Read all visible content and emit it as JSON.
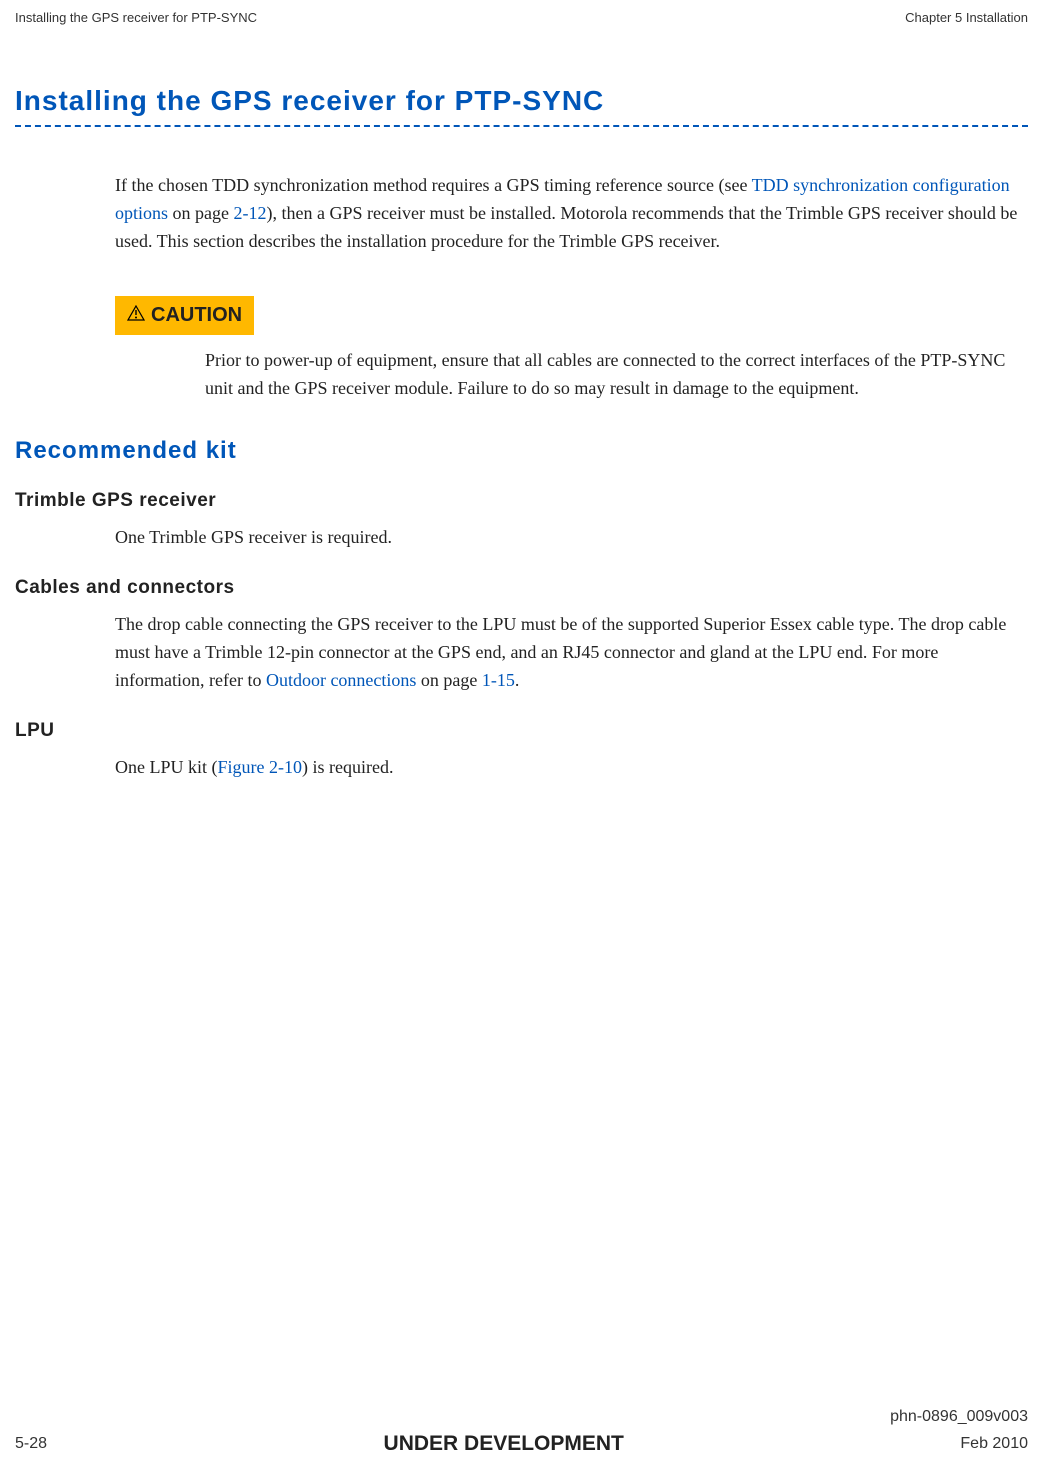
{
  "header": {
    "left": "Installing the GPS receiver for PTP-SYNC",
    "right": "Chapter 5 Installation"
  },
  "title": "Installing the GPS receiver for PTP-SYNC",
  "intro_part1": "If the chosen TDD synchronization method requires a GPS timing reference source (see ",
  "intro_link1": "TDD synchronization configuration options",
  "intro_part2": " on page ",
  "intro_link2": "2-12",
  "intro_part3": "), then a GPS receiver must be installed. Motorola recommends that the Trimble GPS receiver should be used. This section describes the installation procedure for the Trimble GPS receiver.",
  "caution_label": "CAUTION",
  "caution_text": "Prior to power-up of equipment, ensure that all cables are connected to the correct interfaces of the PTP-SYNC unit and the GPS receiver module. Failure to do so may result in damage to the equipment.",
  "h2_recommended": "Recommended kit",
  "h3_trimble": "Trimble GPS receiver",
  "trimble_text": "One Trimble GPS receiver is required.",
  "h3_cables": "Cables and connectors",
  "cables_part1": "The drop cable connecting the GPS receiver to the LPU must be of the supported Superior Essex cable type. The drop cable must have a Trimble 12-pin connector at the GPS end, and an RJ45 connector and gland at the LPU end. For more information, refer to ",
  "cables_link1": "Outdoor connections",
  "cables_part2": " on page ",
  "cables_link2": "1-15",
  "cables_part3": ".",
  "h3_lpu": "LPU",
  "lpu_part1": "One LPU kit (",
  "lpu_link1": "Figure 2-10",
  "lpu_part2": ") is required.",
  "footer": {
    "doc_id": "phn-0896_009v003",
    "page_num": "5-28",
    "status": "UNDER DEVELOPMENT",
    "date": "Feb 2010"
  }
}
